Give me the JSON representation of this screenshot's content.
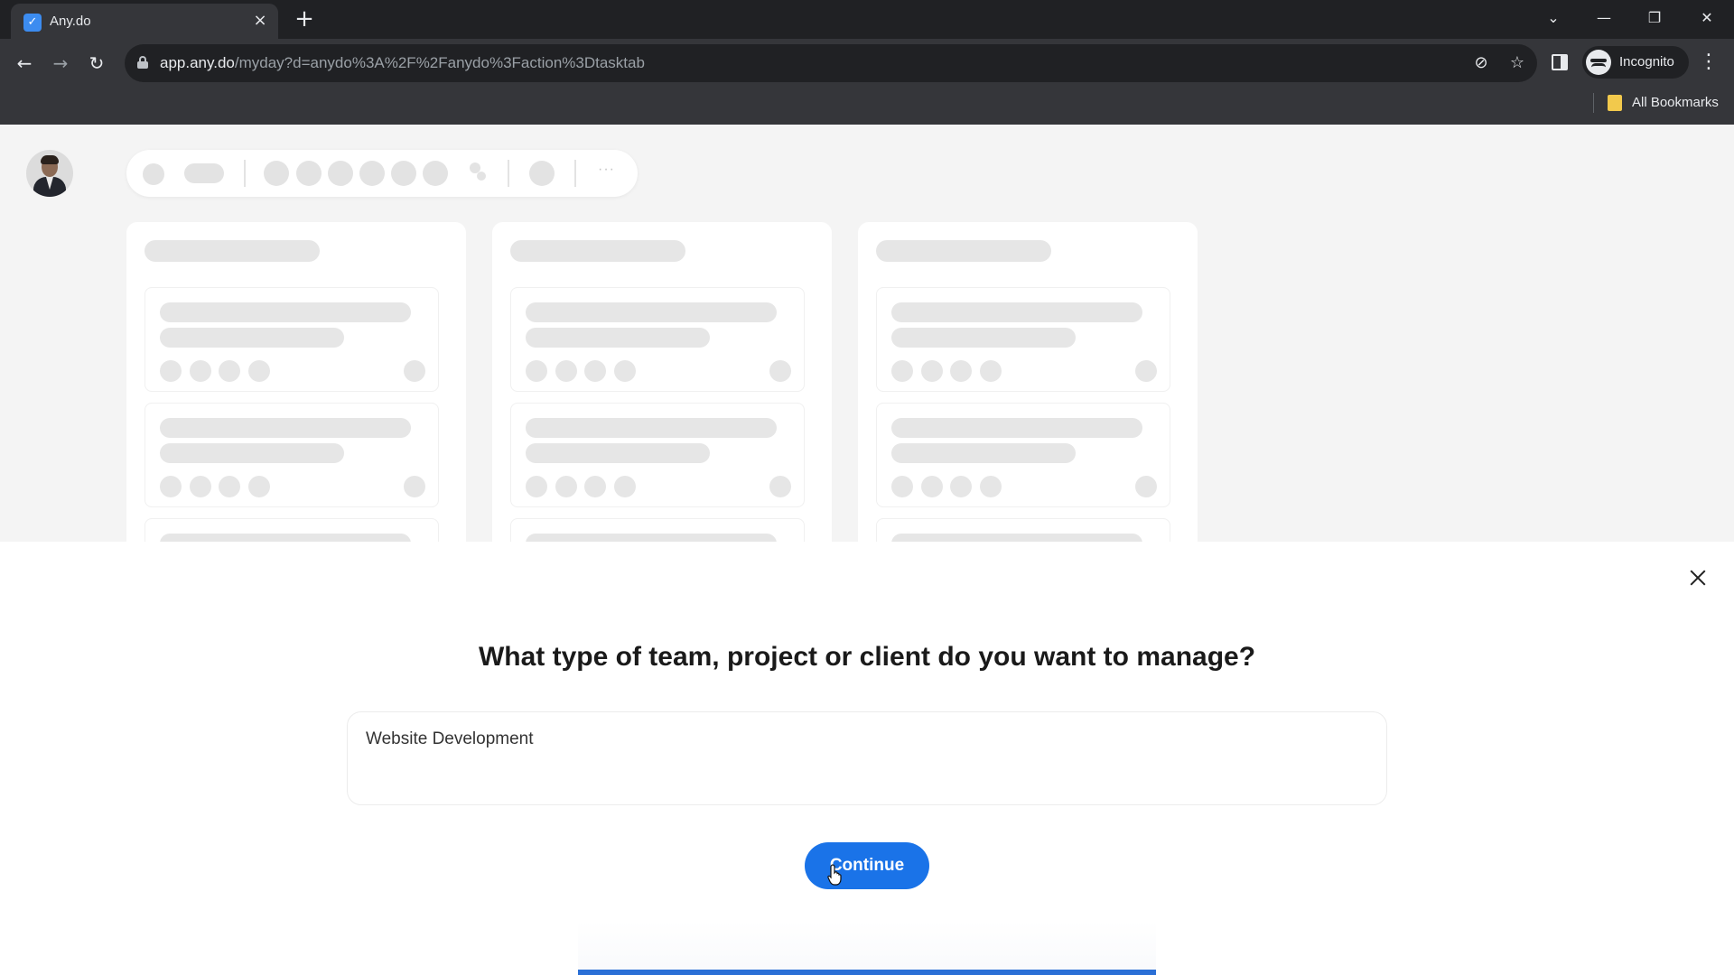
{
  "browser": {
    "tab_title": "Any.do",
    "tab_favicon": "✓",
    "url_host": "app.any.do",
    "url_path": "/myday?d=anydo%3A%2F%2Fanydo%3Faction%3Dtasktab",
    "profile_label": "Incognito",
    "bookmarks_label": "All Bookmarks",
    "icons": {
      "tab_close": "×",
      "new_tab": "+",
      "back": "←",
      "forward": "→",
      "reload": "↻",
      "eye_off": "⊘",
      "star": "☆",
      "menu": "⋮",
      "tab_search": "⌄",
      "minimize": "—",
      "restore": "❐",
      "close": "✕"
    }
  },
  "app": {
    "more_label": "···"
  },
  "modal": {
    "question": "What type of team, project or client do you want to manage?",
    "answer_value": "Website Development",
    "continue_label": "Continue",
    "progress_fraction": 1.0
  },
  "colors": {
    "accent": "#1a73e8",
    "progress": "#2a6fd6",
    "skeleton": "#e3e3e3"
  }
}
